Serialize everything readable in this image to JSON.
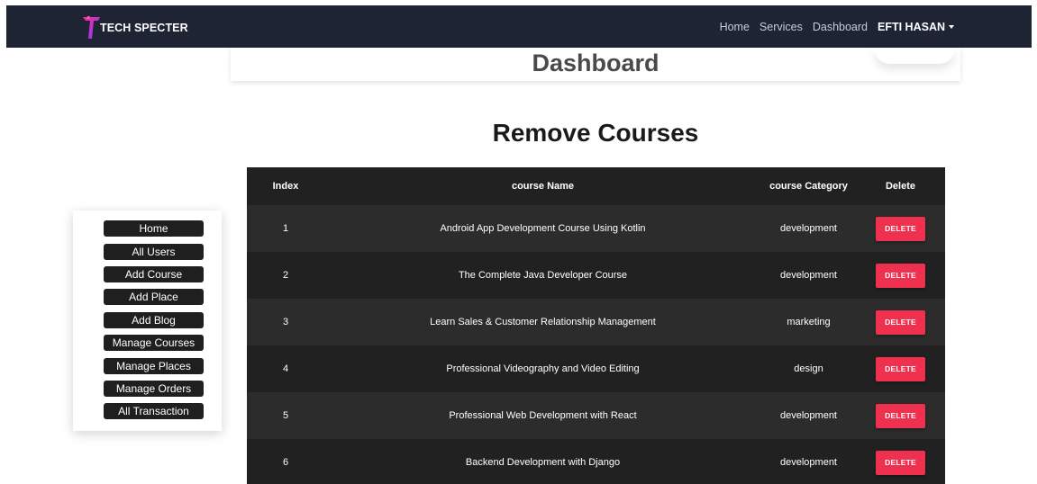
{
  "navbar": {
    "brand": "TECH SPECTER",
    "links": [
      "Home",
      "Services",
      "Dashboard"
    ],
    "user": "EFTI HASAN"
  },
  "dashboard": {
    "title": "Dashboard"
  },
  "section": {
    "title": "Remove Courses"
  },
  "sidebar": {
    "items": [
      "Home",
      "All Users",
      "Add Course",
      "Add Place",
      "Add Blog",
      "Manage Courses",
      "Manage Places",
      "Manage Orders",
      "All Transaction"
    ]
  },
  "table": {
    "headers": [
      "Index",
      "course Name",
      "course Category",
      "Delete"
    ],
    "delete_label": "DELETE",
    "rows": [
      {
        "index": "1",
        "name": "Android App Development Course Using Kotlin",
        "category": "development"
      },
      {
        "index": "2",
        "name": "The Complete Java Developer Course",
        "category": "development"
      },
      {
        "index": "3",
        "name": "Learn Sales & Customer Relationship Management",
        "category": "marketing"
      },
      {
        "index": "4",
        "name": "Professional Videography and Video Editing",
        "category": "design"
      },
      {
        "index": "5",
        "name": "Professional Web Development with React",
        "category": "development"
      },
      {
        "index": "6",
        "name": "Backend Development with Django",
        "category": "development"
      }
    ]
  },
  "colors": {
    "navbar_bg": "#1e2433",
    "delete_button": "#f0304f",
    "table_dark": "#212121",
    "table_light": "#2c2c2c"
  }
}
